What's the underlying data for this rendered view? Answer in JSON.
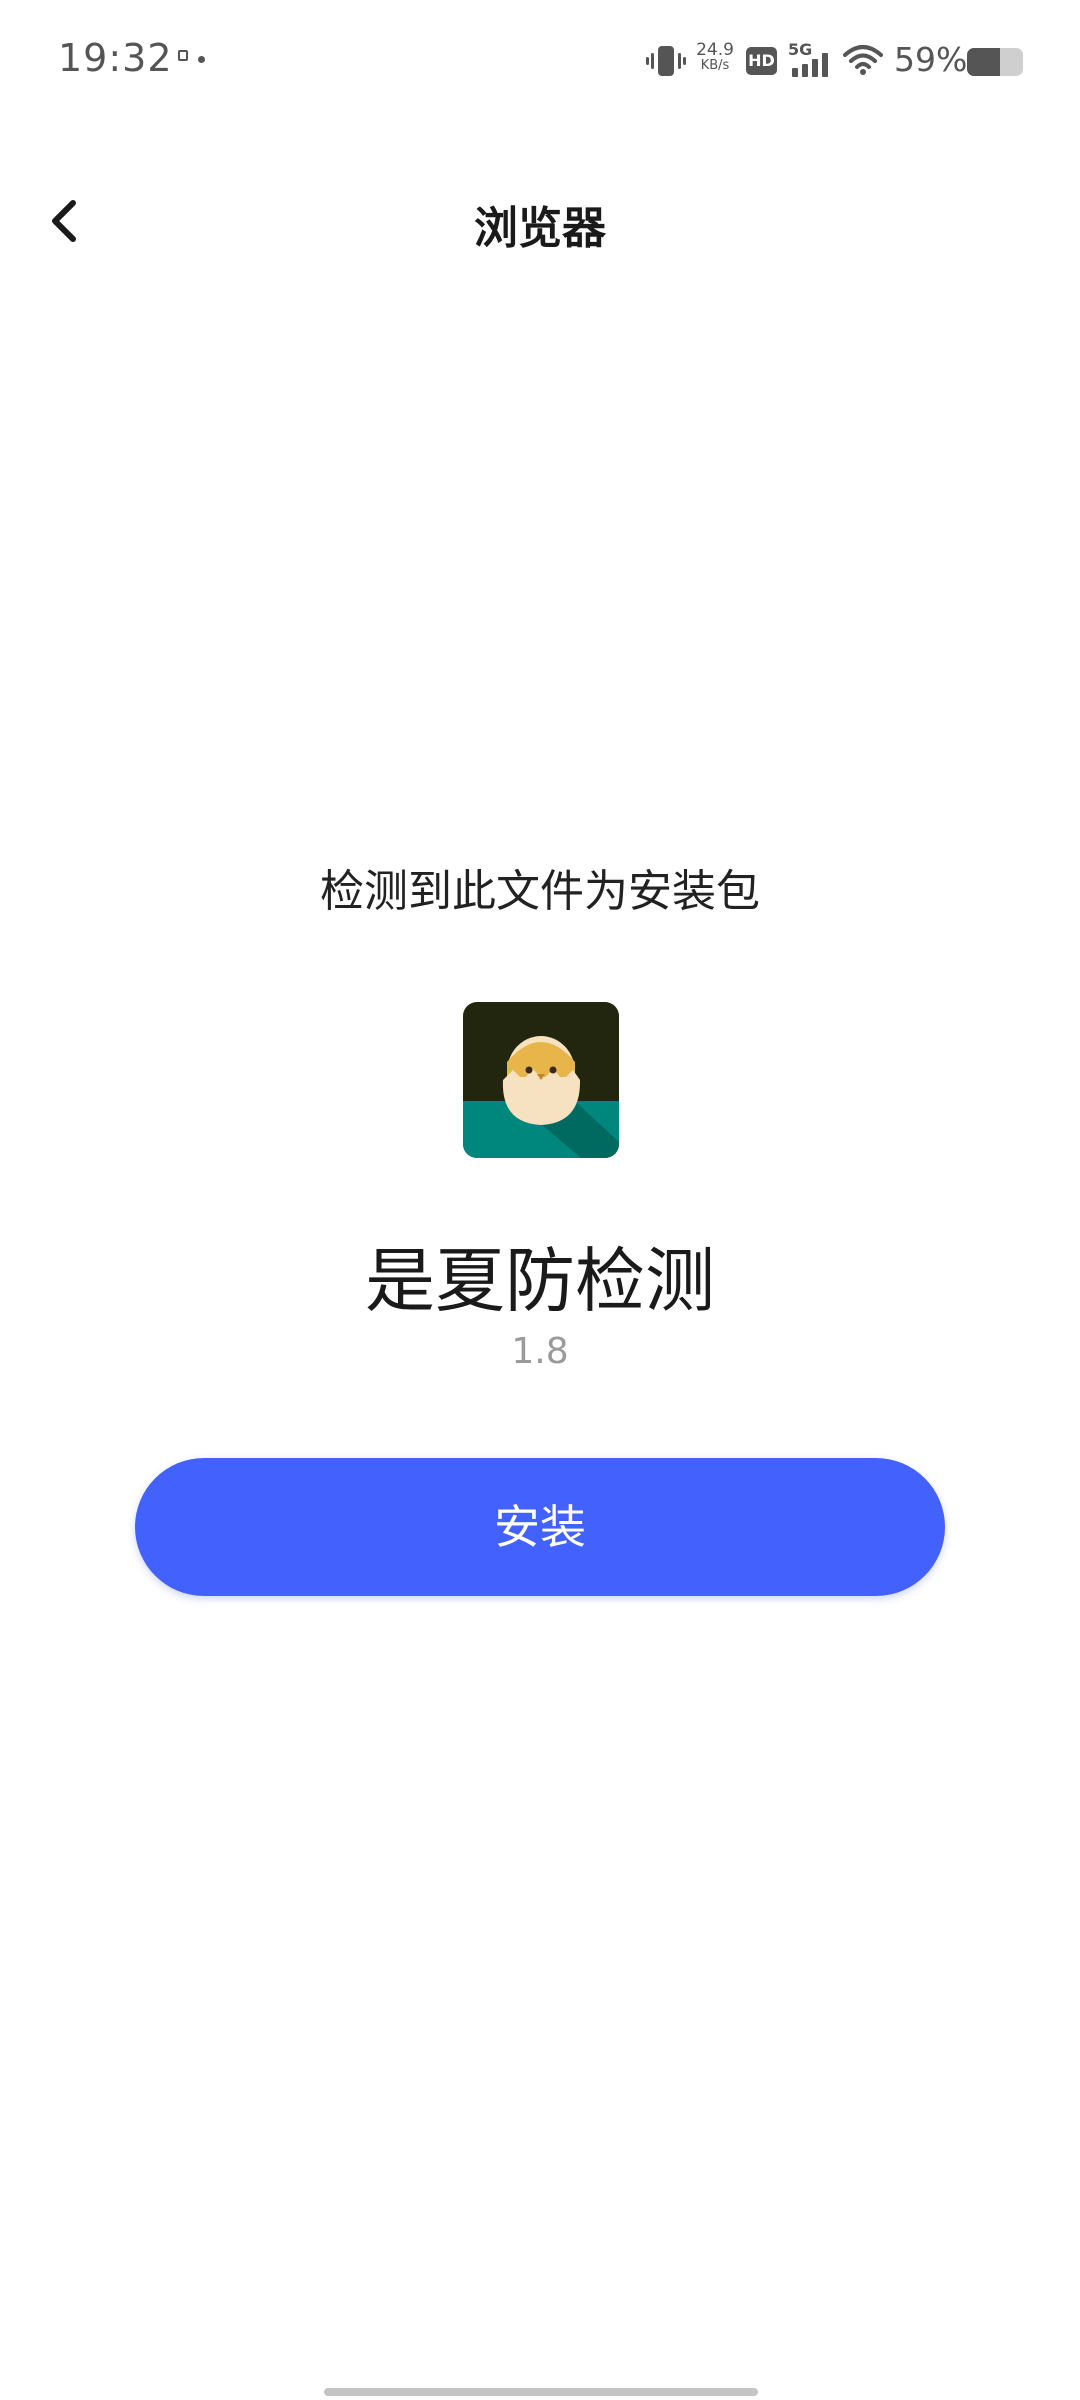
{
  "status_bar": {
    "time": "19:32",
    "net_speed_value": "24.9",
    "net_speed_unit": "KB/s",
    "hd_label": "HD",
    "network_label": "5G",
    "battery_percent_text": "59%",
    "battery_level": 0.59,
    "icons": [
      "notification-icon",
      "vibrate-icon",
      "hd-icon",
      "signal-5g-icon",
      "wifi-icon",
      "battery-icon"
    ]
  },
  "header": {
    "title": "浏览器",
    "back_icon": "chevron-left-icon"
  },
  "content": {
    "detect_message": "检测到此文件为安装包",
    "app_name": "是夏防检测",
    "app_version": "1.8",
    "install_label": "安装"
  },
  "colors": {
    "accent": "#4361fd",
    "icon_dark_bg": "#22260f",
    "icon_teal": "#00877d",
    "egg_shell": "#f6e1c0",
    "chick_yellow": "#e7b54a"
  }
}
